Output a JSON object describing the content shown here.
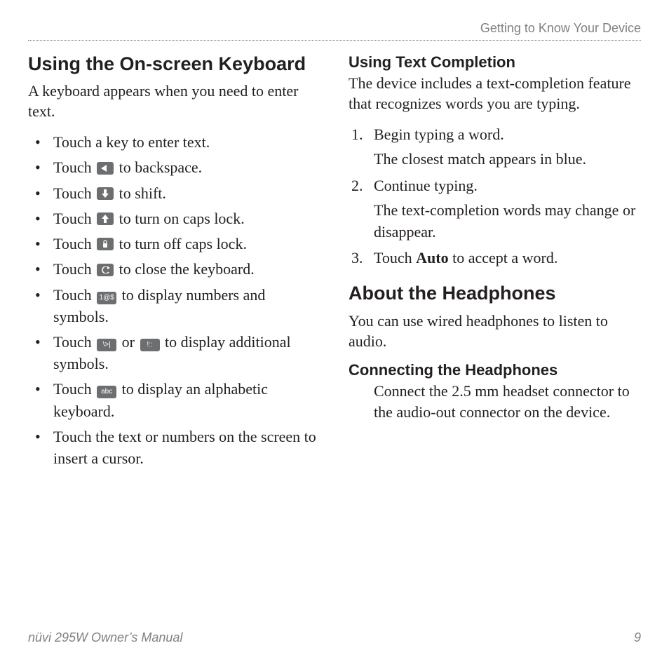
{
  "header": "Getting to Know Your Device",
  "left": {
    "h1": "Using the On-screen Keyboard",
    "intro": "A keyboard appears when you need to enter text.",
    "bullets": {
      "b1": "Touch a key to enter text.",
      "b2a": "Touch ",
      "b2b": " to backspace.",
      "b3a": "Touch ",
      "b3b": " to shift.",
      "b4a": "Touch ",
      "b4b": " to turn on caps lock.",
      "b5a": "Touch ",
      "b5b": "  to turn off caps lock.",
      "b6a": "Touch ",
      "b6b": " to close the keyboard.",
      "b7a": "Touch ",
      "b7b": " to display numbers and symbols.",
      "b8a": "Touch ",
      "b8mid": " or ",
      "b8b": " to display additional symbols.",
      "b9a": "Touch ",
      "b9b": " to display an alphabetic keyboard.",
      "b10": "Touch the text or numbers on the screen to insert a cursor."
    },
    "icons": {
      "backspace": "◄",
      "shift": "↓",
      "caps_on": "↑",
      "caps_off": "🔒",
      "close": "↩",
      "numsym": "1@$",
      "sym1": "\\>|",
      "sym2": "!::",
      "abc": "abc"
    }
  },
  "right": {
    "h2a": "Using Text Completion",
    "p1": "The device includes a text-completion feature that recognizes words you are typing.",
    "steps": {
      "s1": "Begin typing a word.",
      "s1sub": "The closest match appears in blue.",
      "s2": "Continue typing.",
      "s2sub": "The text-completion words may change or disappear.",
      "s3a": "Touch ",
      "s3bold": "Auto",
      "s3b": " to accept a word."
    },
    "h1b": "About the Headphones",
    "p2": "You can use wired headphones to listen to audio.",
    "h2b": "Connecting the Headphones",
    "p3": "Connect the 2.5 mm headset connector to the audio-out connector on the device."
  },
  "footer": {
    "left": "nüvi 295W Owner’s Manual",
    "right": "9"
  }
}
